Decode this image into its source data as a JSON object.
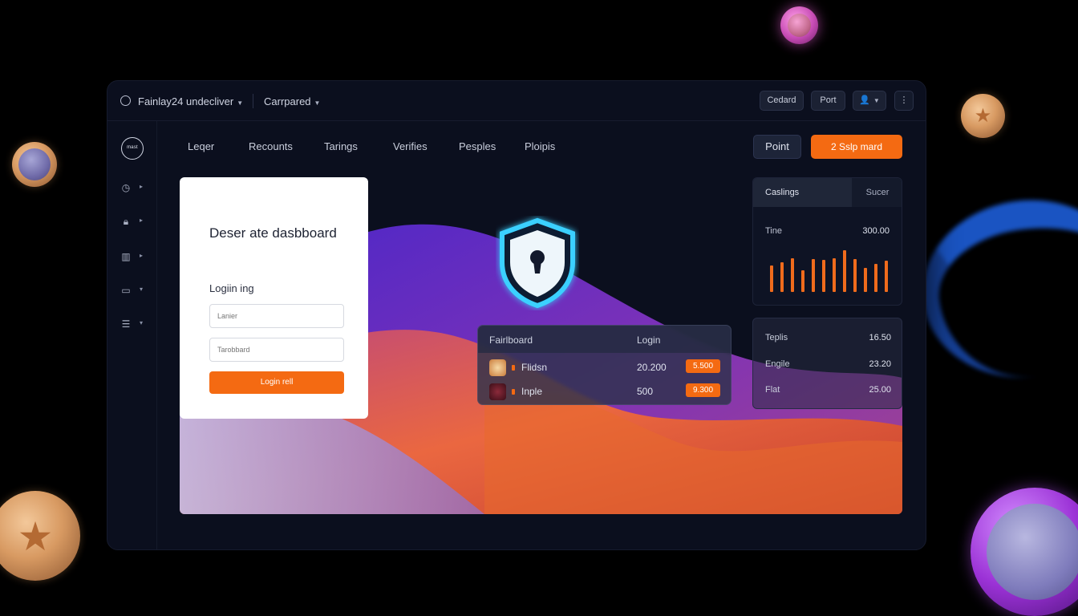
{
  "topbar": {
    "workspace": "Fainlay24 undecliver",
    "workspace2": "Carrpared",
    "btn_cedard": "Cedard",
    "btn_port": "Port"
  },
  "sidebar": {
    "logo_text": "mast",
    "items": [
      {
        "icon": "clock-icon"
      },
      {
        "icon": "lock-icon"
      },
      {
        "icon": "columns-icon"
      },
      {
        "icon": "card-icon"
      },
      {
        "icon": "filter-icon"
      }
    ]
  },
  "nav": {
    "links": [
      "Leqer",
      "Recounts",
      "Tarings",
      "Verifies",
      "Pesples",
      "Ploipis"
    ],
    "btn_point": "Point",
    "btn_primary": "2 Sslp mard"
  },
  "login": {
    "title": "Deser ate dasbboard",
    "label": "Logiin ing",
    "field1_placeholder": "Lanier",
    "field2_placeholder": "Tarobbard",
    "submit": "Login rell"
  },
  "leaderboard": {
    "col1": "Fairlboard",
    "col2": "Login",
    "rows": [
      {
        "name": "Flidsn",
        "score": "20.200",
        "badge": "5.500"
      },
      {
        "name": "Inple",
        "score": "500",
        "badge": "9.300"
      }
    ]
  },
  "rankings": {
    "tab_active": "Caslings",
    "tab_other": "Sucer",
    "label": "Tine",
    "value": "300.00",
    "bar_levels": [
      0.62,
      0.68,
      0.78,
      0.5,
      0.76,
      0.74,
      0.78,
      0.96,
      0.76,
      0.56,
      0.64,
      0.72
    ]
  },
  "stats": {
    "rows": [
      {
        "k": "Teplis",
        "v": "16.50"
      },
      {
        "k": "Engile",
        "v": "23.20"
      },
      {
        "k": "Flat",
        "v": "25.00"
      }
    ]
  },
  "colors": {
    "accent": "#f46a12",
    "bg": "#0b0f1e",
    "shield_glow": "#34c8ff"
  }
}
